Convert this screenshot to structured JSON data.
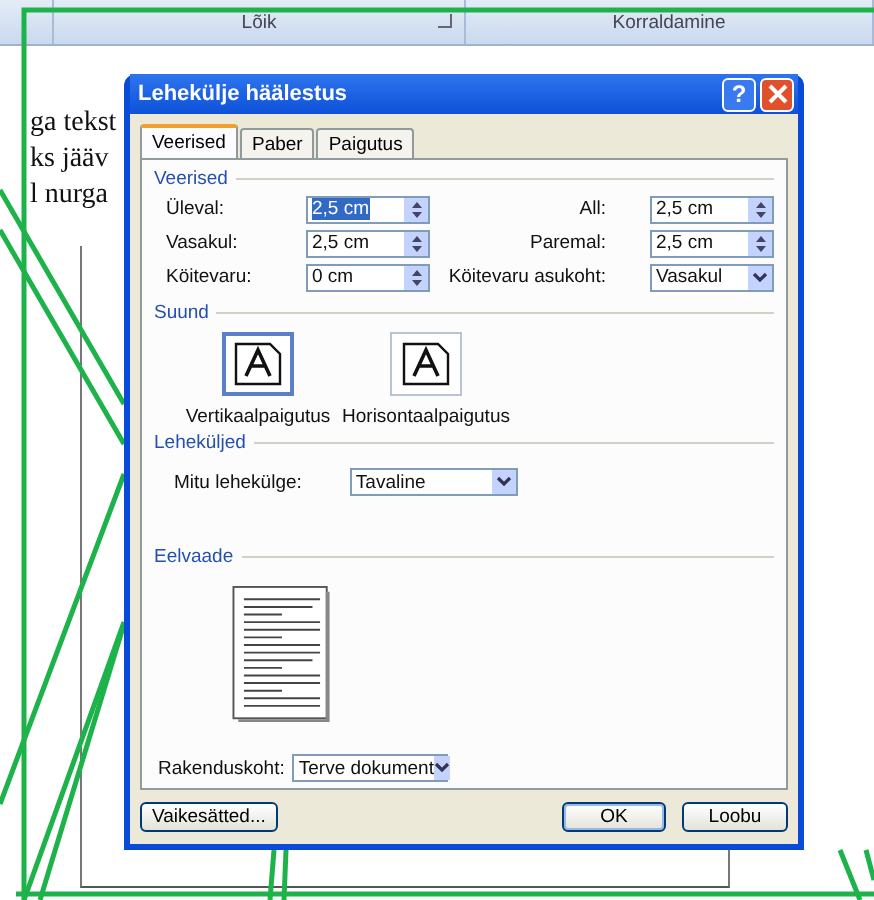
{
  "ribbon": {
    "groups": [
      {
        "label": "Lõik",
        "launcher": true
      },
      {
        "label": "Korraldamine",
        "launcher": false
      }
    ]
  },
  "document": {
    "lines": [
      "ga tekst",
      "ks jääv",
      "l nurga"
    ]
  },
  "dialog": {
    "title": "Lehekülje häälestus",
    "help": "?",
    "tabs": [
      {
        "label": "Veerised",
        "selected": true
      },
      {
        "label": "Paber",
        "selected": false
      },
      {
        "label": "Paigutus",
        "selected": false
      }
    ],
    "margins": {
      "label": "Veerised",
      "fields": [
        {
          "label": "Üleval:",
          "value": "2,5 cm",
          "kind": "spin",
          "text_selected": true
        },
        {
          "label": "All:",
          "value": "2,5 cm",
          "kind": "spin",
          "text_selected": false
        },
        {
          "label": "Vasakul:",
          "value": "2,5 cm",
          "kind": "spin",
          "text_selected": false
        },
        {
          "label": "Paremal:",
          "value": "2,5 cm",
          "kind": "spin",
          "text_selected": false
        },
        {
          "label": "Köitevaru:",
          "value": "0 cm",
          "kind": "spin",
          "text_selected": false
        },
        {
          "label": "Köitevaru asukoht:",
          "value": "Vasakul",
          "kind": "select",
          "text_selected": false
        }
      ]
    },
    "orientation": {
      "label": "Suund",
      "options": [
        {
          "label": "Vertikaalpaigutus",
          "selected": true
        },
        {
          "label": "Horisontaalpaigutus",
          "selected": false
        }
      ]
    },
    "pages": {
      "label": "Leheküljed",
      "field_label": "Mitu lehekülge:",
      "value": "Tavaline"
    },
    "preview": {
      "label": "Eelvaade",
      "apply_label": "Rakenduskoht:",
      "apply_value": "Terve dokument"
    },
    "buttons": [
      {
        "label": "Vaikesätted...",
        "kind": "secondary"
      },
      {
        "label": "OK",
        "kind": "default"
      },
      {
        "label": "Loobu",
        "kind": "secondary"
      }
    ]
  }
}
